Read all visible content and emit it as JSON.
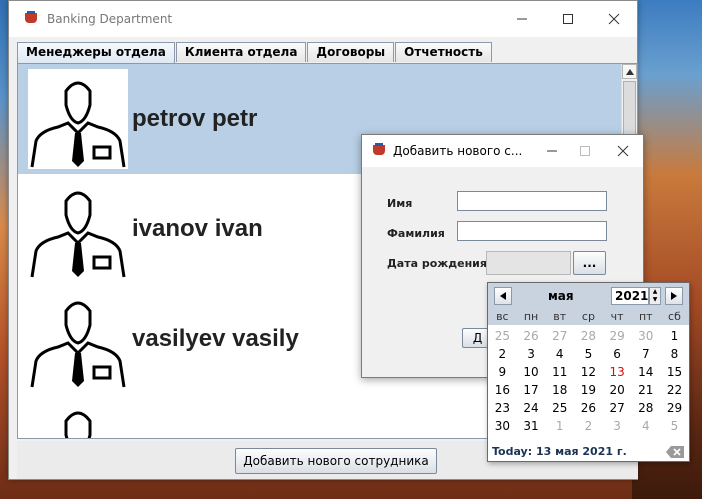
{
  "window": {
    "title": "Banking Department",
    "minimize_icon": "minimize-icon",
    "maximize_icon": "maximize-icon",
    "close_icon": "close-icon"
  },
  "tabs": [
    {
      "label": "Менеджеры отдела",
      "active": true
    },
    {
      "label": "Клиента отдела",
      "active": false
    },
    {
      "label": "Договоры",
      "active": false
    },
    {
      "label": "Отчетность",
      "active": false
    }
  ],
  "employees": [
    {
      "name": "petrov petr",
      "selected": true
    },
    {
      "name": "ivanov ivan",
      "selected": false
    },
    {
      "name": "vasilyev vasily",
      "selected": false
    },
    {
      "name": "",
      "selected": false
    }
  ],
  "bottom": {
    "add_button_label": "Добавить нового сотрудника"
  },
  "dialog": {
    "title": "Добавить нового с...",
    "first_name_label": "Имя",
    "first_name_value": "",
    "last_name_label": "Фамилия",
    "last_name_value": "",
    "birth_date_label": "Дата рождения",
    "birth_date_value": "",
    "date_picker_button": "...",
    "hidden_button_label": "Д"
  },
  "calendar": {
    "month": "мая",
    "year": "2021",
    "prev_icon": "triangle-left-icon",
    "next_icon": "triangle-right-icon",
    "weekdays": [
      "вс",
      "пн",
      "вт",
      "ср",
      "чт",
      "пт",
      "сб"
    ],
    "weeks": [
      [
        "25",
        "26",
        "27",
        "28",
        "29",
        "30",
        "1"
      ],
      [
        "2",
        "3",
        "4",
        "5",
        "6",
        "7",
        "8"
      ],
      [
        "9",
        "10",
        "11",
        "12",
        "13",
        "14",
        "15"
      ],
      [
        "16",
        "17",
        "18",
        "19",
        "20",
        "21",
        "22"
      ],
      [
        "23",
        "24",
        "25",
        "26",
        "27",
        "28",
        "29"
      ],
      [
        "30",
        "31",
        "1",
        "2",
        "3",
        "4",
        "5"
      ]
    ],
    "today_label": "Today: 13 мая 2021 г.",
    "today_color": "#d01010",
    "other_month_color": "#a9a9a9"
  }
}
